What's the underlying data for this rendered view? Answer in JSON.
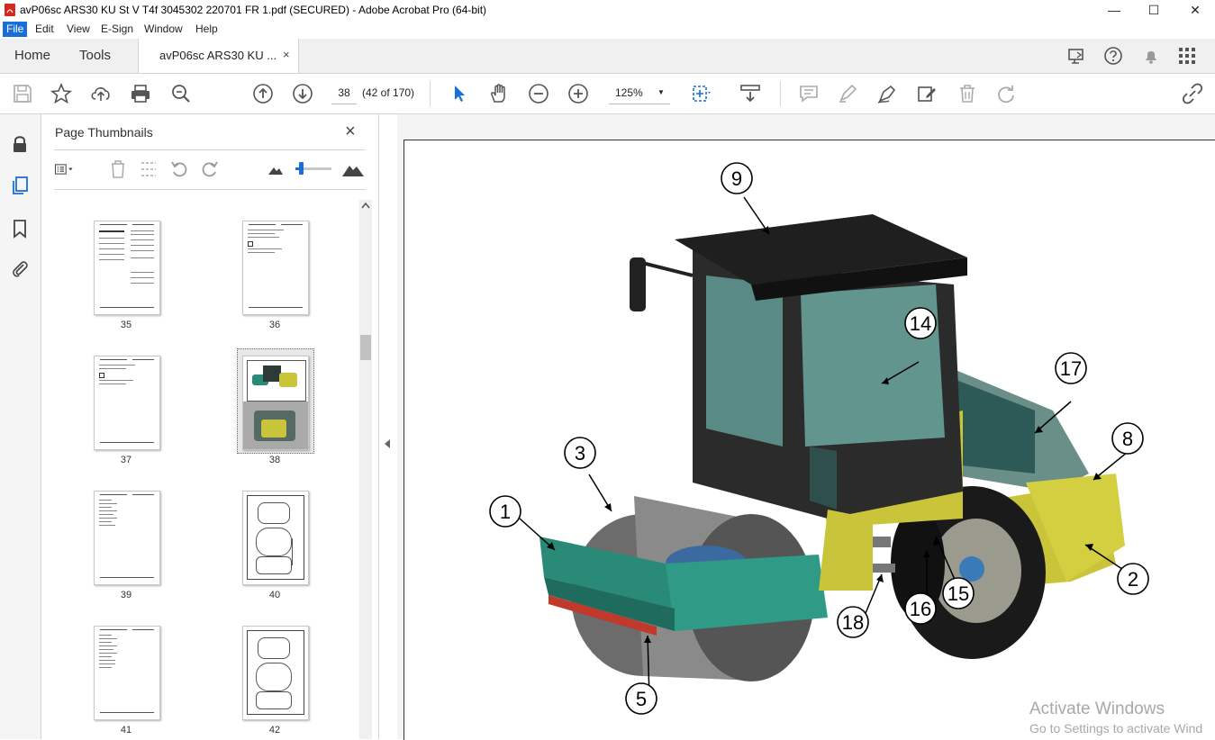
{
  "window": {
    "title": "avP06sc ARS30 KU St V T4f 3045302 220701 FR 1.pdf (SECURED) - Adobe Acrobat Pro (64-bit)",
    "minimize": "—",
    "maximize": "☐",
    "close": "✕"
  },
  "menu": [
    "File",
    "Edit",
    "View",
    "E-Sign",
    "Window",
    "Help"
  ],
  "tabs": {
    "home": "Home",
    "tools": "Tools",
    "document": "avP06sc ARS30 KU ...",
    "close": "×"
  },
  "toolbar": {
    "page_number": "38",
    "page_count": "(42 of 170)",
    "zoom": "125%"
  },
  "thumbnails_panel": {
    "title": "Page Thumbnails",
    "close": "×",
    "pages": [
      "35",
      "36",
      "37",
      "38",
      "39",
      "40",
      "41",
      "42"
    ],
    "selected_page": "38"
  },
  "document": {
    "callouts": [
      "9",
      "14",
      "17",
      "8",
      "3",
      "1",
      "2",
      "15",
      "16",
      "18",
      "5"
    ]
  },
  "watermark": {
    "line1": "Activate Windows",
    "line2": "Go to Settings to activate Wind"
  },
  "colors": {
    "accent": "#1a6ed8",
    "machine_yellow": "#c9c43a",
    "drum_frame": "#2a8a78"
  }
}
